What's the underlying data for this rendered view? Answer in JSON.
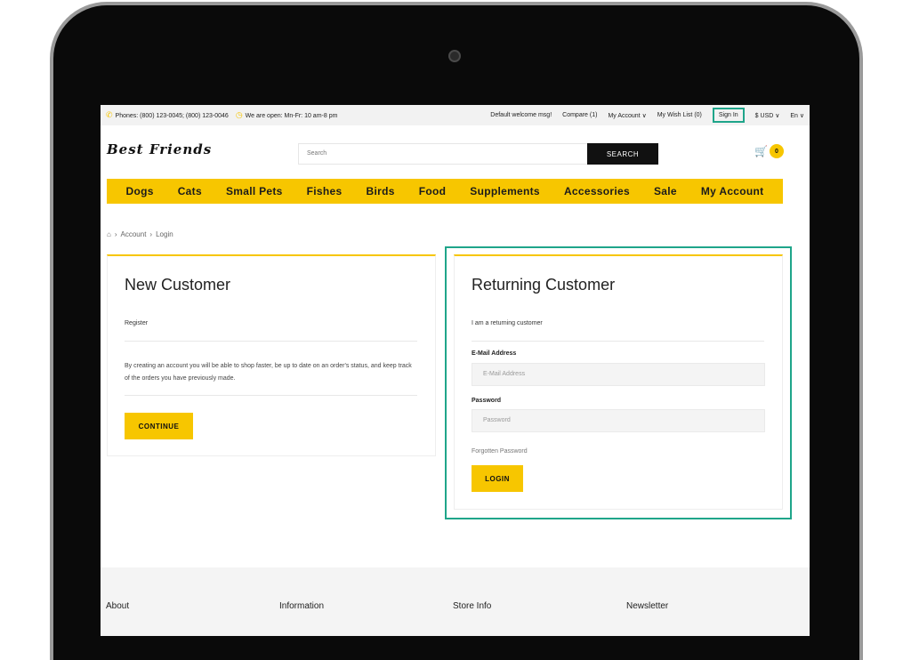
{
  "topbar": {
    "phones": "Phones: (800) 123-0045; (800) 123-0046",
    "hours": "We are open: Mn-Fr: 10 am-8 pm",
    "welcome": "Default welcome msg!",
    "compare": "Compare (1)",
    "my_account": "My Account ∨",
    "wish_list": "My Wish List (0)",
    "sign_in": "Sign In",
    "currency": "$ USD ∨",
    "language": "En ∨"
  },
  "header": {
    "logo": "Best Friends",
    "search_placeholder": "Search",
    "search_button": "SEARCH",
    "cart_count": "0"
  },
  "nav": [
    "Dogs",
    "Cats",
    "Small Pets",
    "Fishes",
    "Birds",
    "Food",
    "Supplements",
    "Accessories",
    "Sale",
    "My Account"
  ],
  "breadcrumb": [
    "Account",
    "Login"
  ],
  "new_customer": {
    "title": "New Customer",
    "subtitle": "Register",
    "description": "By creating an account you will be able to shop faster, be up to date on an order's status, and keep track of the orders you have previously made.",
    "button": "CONTINUE"
  },
  "returning_customer": {
    "title": "Returning Customer",
    "subtitle": "I am a returning customer",
    "email_label": "E-Mail Address",
    "email_placeholder": "E-Mail Address",
    "password_label": "Password",
    "password_placeholder": "Password",
    "forgot": "Forgotten Password",
    "button": "LOGIN"
  },
  "footer": [
    "About",
    "Information",
    "Store Info",
    "Newsletter"
  ],
  "colors": {
    "accent": "#f7c600",
    "highlight": "#1fa58a"
  }
}
